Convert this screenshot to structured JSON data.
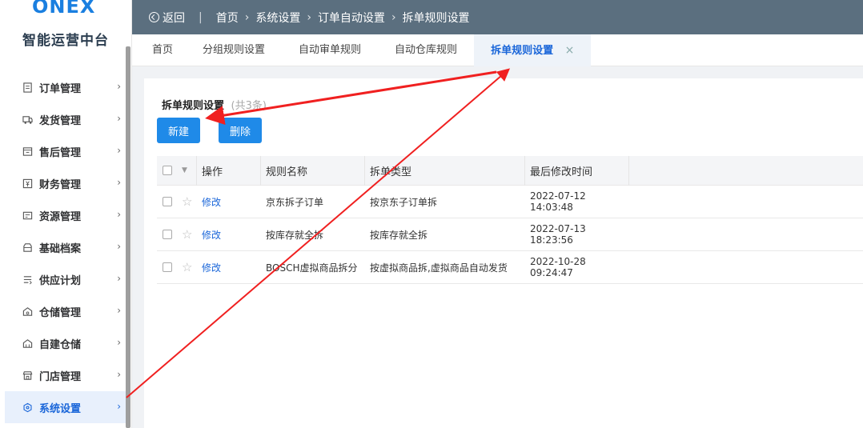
{
  "logo": {
    "brand": "ONEX",
    "subtitle": "智能运营中台"
  },
  "sidebar": {
    "items": [
      {
        "label": "订单管理",
        "icon": "document-icon"
      },
      {
        "label": "发货管理",
        "icon": "truck-icon"
      },
      {
        "label": "售后管理",
        "icon": "after-sale-icon"
      },
      {
        "label": "财务管理",
        "icon": "finance-icon"
      },
      {
        "label": "资源管理",
        "icon": "resource-icon"
      },
      {
        "label": "基础档案",
        "icon": "archive-icon"
      },
      {
        "label": "供应计划",
        "icon": "supply-icon"
      },
      {
        "label": "仓储管理",
        "icon": "warehouse-icon"
      },
      {
        "label": "自建仓储",
        "icon": "self-warehouse-icon"
      },
      {
        "label": "门店管理",
        "icon": "store-icon"
      },
      {
        "label": "系统设置",
        "icon": "settings-icon",
        "active": true
      }
    ]
  },
  "topbar": {
    "back_label": "返回",
    "breadcrumb": [
      "首页",
      "系统设置",
      "订单自动设置",
      "拆单规则设置"
    ]
  },
  "tabs": [
    {
      "label": "首页"
    },
    {
      "label": "分组规则设置"
    },
    {
      "label": "自动审单规则"
    },
    {
      "label": "自动仓库规则"
    },
    {
      "label": "拆单规则设置",
      "active": true,
      "close": "×"
    }
  ],
  "card": {
    "title": "拆单规则设置",
    "count": "(共3条)",
    "new_button": "新建",
    "delete_button": "删除"
  },
  "table": {
    "headers": {
      "op": "操作",
      "name": "规则名称",
      "type": "拆单类型",
      "time": "最后修改时间"
    },
    "rows": [
      {
        "op": "修改",
        "name": "京东拆子订单",
        "type": "按京东子订单拆",
        "time": "2022-07-12 14:03:48"
      },
      {
        "op": "修改",
        "name": "按库存就全拆",
        "type": "按库存就全拆",
        "time": "2022-07-13 18:23:56"
      },
      {
        "op": "修改",
        "name": "BOSCH虚拟商品拆分",
        "type": "按虚拟商品拆,虚拟商品自动发货",
        "time": "2022-10-28 09:24:47"
      }
    ]
  },
  "colors": {
    "accent": "#1f8ae8",
    "topbar": "#5b6f7f",
    "annotation": "#f02020"
  }
}
